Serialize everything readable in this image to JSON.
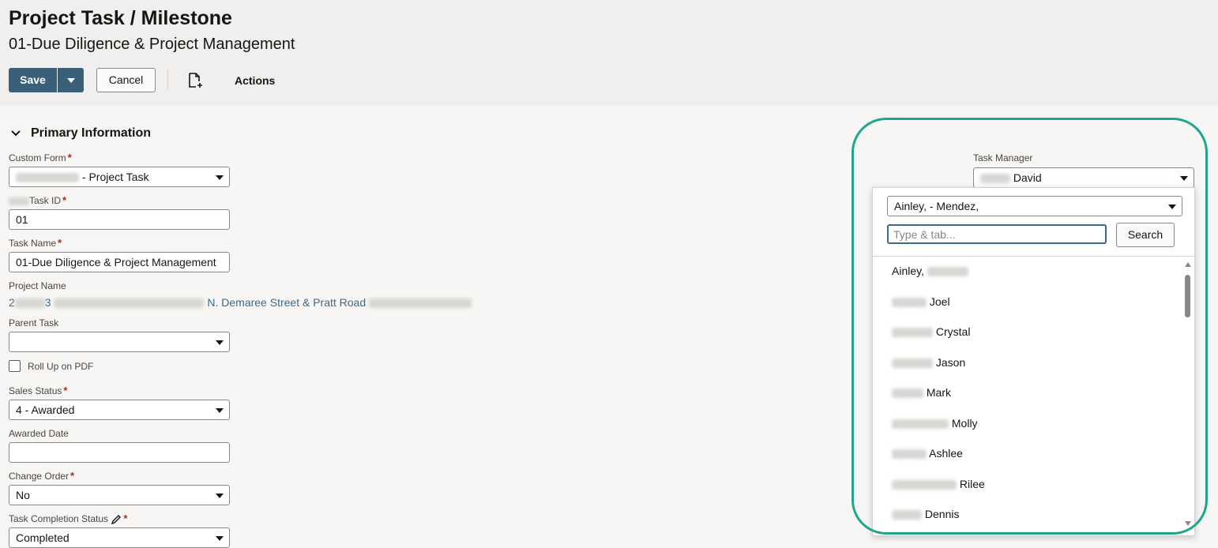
{
  "header": {
    "title": "Project Task / Milestone",
    "subtitle": "01-Due Diligence & Project Management",
    "save_label": "Save",
    "cancel_label": "Cancel",
    "actions_label": "Actions"
  },
  "section": {
    "title": "Primary Information"
  },
  "fields": {
    "custom_form": {
      "label": "Custom Form",
      "value": "- Project Task"
    },
    "task_id": {
      "label": "Task ID",
      "value": "01"
    },
    "task_name": {
      "label": "Task Name",
      "value": "01-Due Diligence & Project Management"
    },
    "project_name": {
      "label": "Project Name",
      "value_start": "2",
      "value_mid": "3",
      "value_end": "N. Demaree Street & Pratt Road"
    },
    "parent_task": {
      "label": "Parent Task",
      "value": ""
    },
    "roll_up": {
      "label": "Roll Up on PDF",
      "checked": false
    },
    "sales_status": {
      "label": "Sales Status",
      "value": "4 - Awarded"
    },
    "awarded_date": {
      "label": "Awarded Date",
      "value": ""
    },
    "change_order": {
      "label": "Change Order",
      "value": "No"
    },
    "task_completion_status": {
      "label": "Task Completion Status",
      "value": "Completed"
    }
  },
  "task_manager": {
    "label": "Task Manager",
    "value": "David",
    "popup": {
      "filter_value": "Ainley, - Mendez,",
      "search_placeholder": "Type & tab...",
      "search_button": "Search",
      "items": [
        "Ainley,",
        "Joel",
        "Crystal",
        "Jason",
        "Mark",
        "Molly",
        "Ashlee",
        "Rilee",
        "Dennis"
      ]
    }
  },
  "colors": {
    "primary": "#3a5f78",
    "highlight": "#1ea68a",
    "link": "#3a6a8a",
    "required": "#b3261e"
  }
}
